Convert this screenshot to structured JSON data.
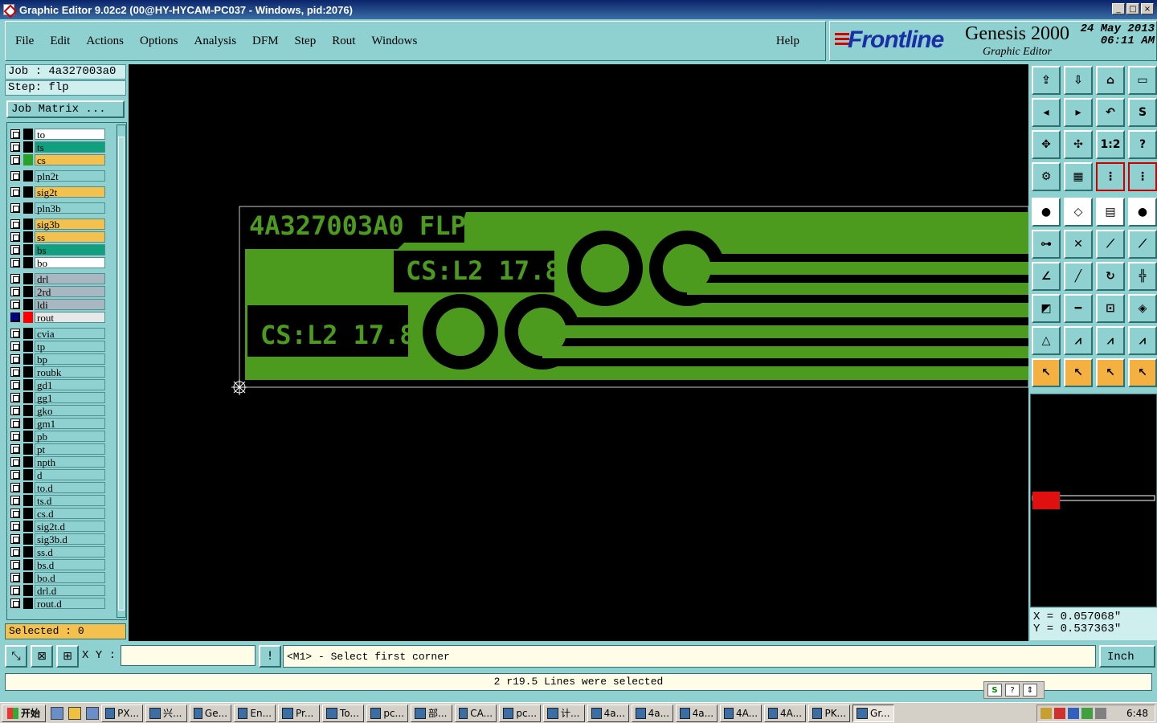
{
  "window": {
    "title": "Graphic Editor 9.02c2 (00@HY-HYCAM-PC037 - Windows, pid:2076)"
  },
  "menu": [
    {
      "label": "File"
    },
    {
      "label": "Edit"
    },
    {
      "label": "Actions"
    },
    {
      "label": "Options"
    },
    {
      "label": "Analysis"
    },
    {
      "label": "DFM"
    },
    {
      "label": "Step"
    },
    {
      "label": "Rout"
    },
    {
      "label": "Windows"
    }
  ],
  "help_label": "Help",
  "brand": {
    "logo": "Frontline",
    "product": "Genesis 2000",
    "subtitle": "Graphic Editor",
    "date": "24 May 2013",
    "time": "06:11 AM"
  },
  "job": {
    "job_line": "Job : 4a327003a0",
    "step_line": "Step: flp",
    "matrix_label": "Job Matrix ..."
  },
  "layers": [
    {
      "name": "to",
      "bg": "#ffffff",
      "swatch": "#000000"
    },
    {
      "name": "ts",
      "bg": "#10a080",
      "swatch": "#000000"
    },
    {
      "name": "cs",
      "bg": "#f4c04e",
      "swatch": "#2aa02a"
    },
    {
      "name": "pln2t",
      "bg": "#8fd0d0",
      "swatch": "#000000"
    },
    {
      "name": "sig2t",
      "bg": "#f4c04e",
      "swatch": "#000000"
    },
    {
      "name": "pln3b",
      "bg": "#8fd0d0",
      "swatch": "#000000"
    },
    {
      "name": "sig3b",
      "bg": "#f4c04e",
      "swatch": "#000000"
    },
    {
      "name": "ss",
      "bg": "#f4c04e",
      "swatch": "#000000"
    },
    {
      "name": "bs",
      "bg": "#10a080",
      "swatch": "#000000"
    },
    {
      "name": "bo",
      "bg": "#ffffff",
      "swatch": "#000000"
    },
    {
      "name": "drl",
      "bg": "#a9b8c0",
      "swatch": "#000000"
    },
    {
      "name": "2rd",
      "bg": "#a9b8c0",
      "swatch": "#000000"
    },
    {
      "name": "ldi",
      "bg": "#a9b8c0",
      "swatch": "#000000"
    },
    {
      "name": "rout",
      "bg": "#e8e8e8",
      "swatch": "#ff0000",
      "checked": true
    },
    {
      "name": "cvia",
      "bg": "#8fd0d0",
      "swatch": "#000000"
    },
    {
      "name": "tp",
      "bg": "#8fd0d0",
      "swatch": "#000000"
    },
    {
      "name": "bp",
      "bg": "#8fd0d0",
      "swatch": "#000000"
    },
    {
      "name": "roubk",
      "bg": "#8fd0d0",
      "swatch": "#000000"
    },
    {
      "name": "gd1",
      "bg": "#8fd0d0",
      "swatch": "#000000"
    },
    {
      "name": "gg1",
      "bg": "#8fd0d0",
      "swatch": "#000000"
    },
    {
      "name": "gko",
      "bg": "#8fd0d0",
      "swatch": "#000000"
    },
    {
      "name": "gm1",
      "bg": "#8fd0d0",
      "swatch": "#000000"
    },
    {
      "name": "pb",
      "bg": "#8fd0d0",
      "swatch": "#000000"
    },
    {
      "name": "pt",
      "bg": "#8fd0d0",
      "swatch": "#000000"
    },
    {
      "name": "npth",
      "bg": "#8fd0d0",
      "swatch": "#000000"
    },
    {
      "name": "d",
      "bg": "#8fd0d0",
      "swatch": "#000000"
    },
    {
      "name": "to.d",
      "bg": "#8fd0d0",
      "swatch": "#000000"
    },
    {
      "name": "ts.d",
      "bg": "#8fd0d0",
      "swatch": "#000000"
    },
    {
      "name": "cs.d",
      "bg": "#8fd0d0",
      "swatch": "#000000"
    },
    {
      "name": "sig2t.d",
      "bg": "#8fd0d0",
      "swatch": "#000000"
    },
    {
      "name": "sig3b.d",
      "bg": "#8fd0d0",
      "swatch": "#000000"
    },
    {
      "name": "ss.d",
      "bg": "#8fd0d0",
      "swatch": "#000000"
    },
    {
      "name": "bs.d",
      "bg": "#8fd0d0",
      "swatch": "#000000"
    },
    {
      "name": "bo.d",
      "bg": "#8fd0d0",
      "swatch": "#000000"
    },
    {
      "name": "drl.d",
      "bg": "#8fd0d0",
      "swatch": "#000000"
    },
    {
      "name": "rout.d",
      "bg": "#8fd0d0",
      "swatch": "#000000"
    }
  ],
  "selected_label": "Selected : 0",
  "canvas": {
    "board_color": "#4c9a1e",
    "text1": "4A327003A0 FLP",
    "text2": "CS:L2 17.8",
    "text3": "CS:L2 17.8"
  },
  "tools": {
    "zoom_ratio_label": "1:2",
    "help_q": "?"
  },
  "coords": {
    "x": "X = 0.057068\"",
    "y": "Y = 0.537363\""
  },
  "bottom": {
    "xy_label": "X Y :",
    "xy_value": "",
    "prompt": "<M1> - Select first corner",
    "units": "Inch",
    "status": "2 r19.5 Lines were selected"
  },
  "taskbar": {
    "start": "开始",
    "tasks": [
      {
        "label": "PX..."
      },
      {
        "label": "兴..."
      },
      {
        "label": "Ge..."
      },
      {
        "label": "En..."
      },
      {
        "label": "Pr..."
      },
      {
        "label": "To..."
      },
      {
        "label": "pc..."
      },
      {
        "label": "部..."
      },
      {
        "label": "CA..."
      },
      {
        "label": "pc..."
      },
      {
        "label": "计..."
      },
      {
        "label": "4a..."
      },
      {
        "label": "4a..."
      },
      {
        "label": "4a..."
      },
      {
        "label": "4A..."
      },
      {
        "label": "4A..."
      },
      {
        "label": "PK..."
      },
      {
        "label": "Gr..."
      }
    ],
    "clock": "6:48"
  }
}
